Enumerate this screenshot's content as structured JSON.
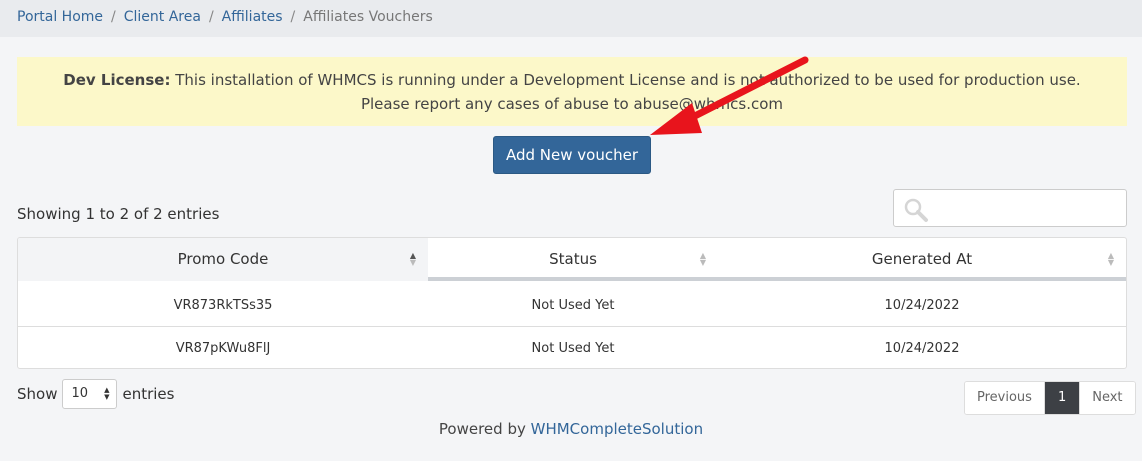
{
  "breadcrumb": {
    "items": [
      {
        "label": "Portal Home"
      },
      {
        "label": "Client Area"
      },
      {
        "label": "Affiliates"
      }
    ],
    "active": "Affiliates Vouchers",
    "separator": "/"
  },
  "alert": {
    "bold": "Dev License:",
    "line1": " This installation of WHMCS is running under a Development License and is not authorized to be used for production use.",
    "line2": "Please report any cases of abuse to abuse@whmcs.com"
  },
  "actions": {
    "add_voucher": "Add New voucher"
  },
  "table_info": "Showing 1 to 2 of 2 entries",
  "search": {
    "placeholder": ""
  },
  "table": {
    "columns": [
      "Promo Code",
      "Status",
      "Generated At"
    ],
    "rows": [
      {
        "promo_code": "VR873RkTSs35",
        "status": "Not Used Yet",
        "generated_at": "10/24/2022"
      },
      {
        "promo_code": "VR87pKWu8FlJ",
        "status": "Not Used Yet",
        "generated_at": "10/24/2022"
      }
    ]
  },
  "length": {
    "show": "Show",
    "value": "10",
    "entries": "entries"
  },
  "pagination": {
    "previous": "Previous",
    "current": "1",
    "next": "Next"
  },
  "footer": {
    "prefix": "Powered by ",
    "link": "WHMCompleteSolution"
  },
  "colors": {
    "primary": "#336699",
    "alert_bg": "#fcf8c9",
    "annotation_arrow": "#e8141c"
  },
  "icons": {
    "search": "search-icon",
    "sort": "sort-icon",
    "select_caret": "select-caret-icon",
    "annotation": "red-arrow-annotation"
  }
}
